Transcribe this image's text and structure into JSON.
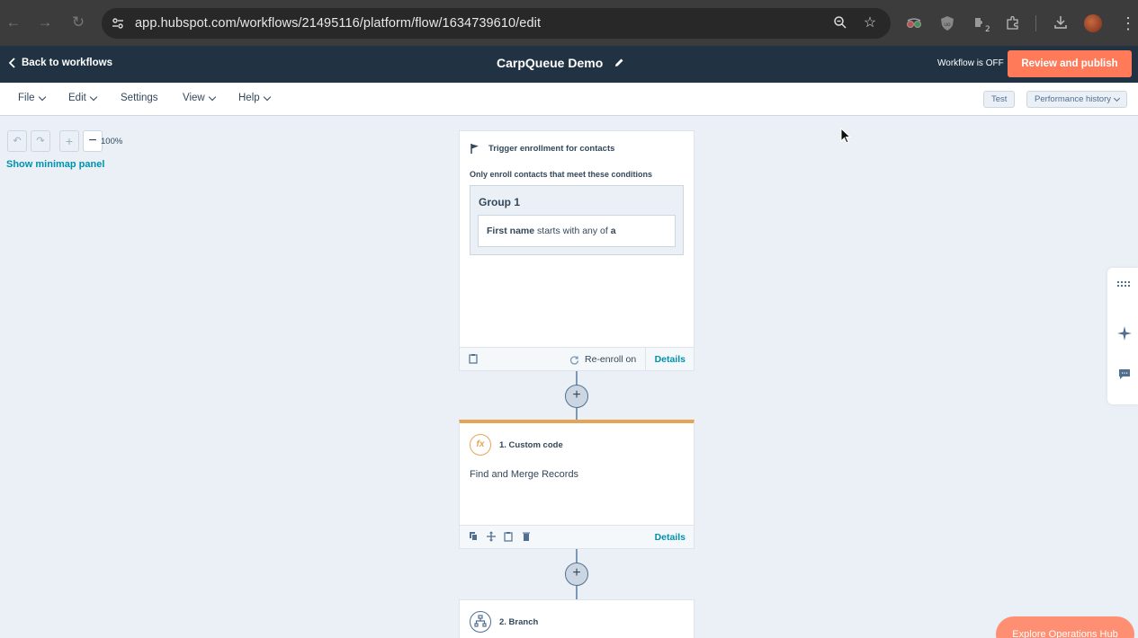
{
  "browser": {
    "url": "app.hubspot.com/workflows/21495116/platform/flow/1634739610/edit",
    "icons": [
      "back-arrow-icon",
      "forward-arrow-icon",
      "reload-icon",
      "site-settings-icon",
      "zoom-icon",
      "bookmark-star-icon",
      "extension-glasses-icon",
      "extension-shield-icon",
      "extension-puzzle-icon",
      "download-icon",
      "profile-avatar",
      "more-vert-icon"
    ],
    "extension_badge": "2"
  },
  "header": {
    "back_label": "Back to workflows",
    "title": "CarpQueue Demo",
    "status": "Workflow is OFF",
    "publish_label": "Review and publish"
  },
  "menu": {
    "items": [
      "File",
      "Edit",
      "Settings",
      "View",
      "Help"
    ],
    "test_label": "Test",
    "history_label": "Performance history"
  },
  "canvas": {
    "zoom": "100%",
    "minimap_label": "Show minimap panel"
  },
  "trigger": {
    "title": "Trigger enrollment for contacts",
    "subtitle": "Only enroll contacts that meet these conditions",
    "group_title": "Group 1",
    "condition_property": "First name",
    "condition_operator": "starts with any of",
    "condition_value": "a",
    "reenroll_label": "Re-enroll on",
    "details_label": "Details"
  },
  "step1": {
    "title": "1. Custom code",
    "body": "Find and Merge Records",
    "details_label": "Details",
    "accent_color": "#e6a556"
  },
  "step2": {
    "title": "2. Branch"
  },
  "footer": {
    "explore_label": "Explore Operations Hub"
  },
  "colors": {
    "header_bg": "#213343",
    "publish_bg": "#ff7a59",
    "link": "#0091ae",
    "canvas_bg": "#eaf0f6"
  }
}
